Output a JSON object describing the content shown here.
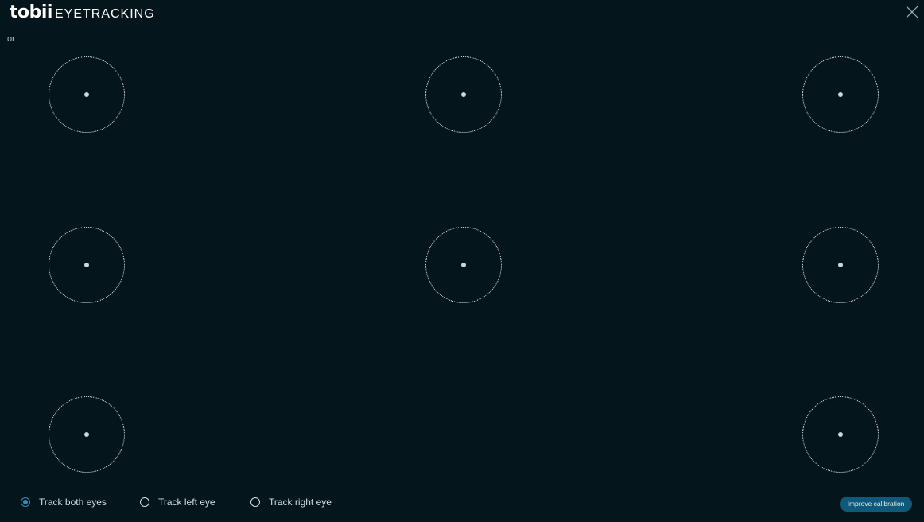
{
  "logo": {
    "brand": "tobii",
    "product": "EYETRACKING"
  },
  "or_text": "or",
  "targets": [
    {
      "label": "top-left"
    },
    {
      "label": "top-center"
    },
    {
      "label": "top-right"
    },
    {
      "label": "middle-left"
    },
    {
      "label": "middle-center"
    },
    {
      "label": "middle-right"
    },
    {
      "label": "bottom-left"
    },
    {
      "label": "bottom-right"
    }
  ],
  "tracking_options": {
    "both": "Track both eyes",
    "left": "Track left eye",
    "right": "Track right eye",
    "selected": "both"
  },
  "improve_button": "Improve calibration",
  "colors": {
    "background": "#04161b",
    "accent": "#2d8ec4",
    "button": "#0f5a7a"
  },
  "icons": {
    "close": "close-icon"
  }
}
